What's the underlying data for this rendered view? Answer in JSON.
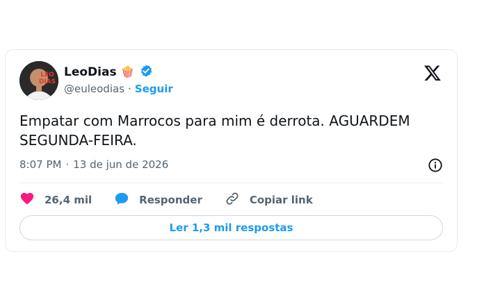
{
  "author": {
    "name": "LeoDias",
    "name_emoji": "🍿",
    "handle": "@euleodias",
    "separator": "·",
    "follow_label": "Seguir",
    "avatar_text": "LEO DIAS",
    "verified": true
  },
  "tweet": {
    "text": "Empatar com Marrocos para mim é derrota. AGUARDEM SEGUNDA-FEIRA.",
    "time": "8:07 PM",
    "date_separator": "·",
    "date": "13 de jun de 2026"
  },
  "actions": {
    "likes_count": "26,4 mil",
    "reply_label": "Responder",
    "copy_link_label": "Copiar link"
  },
  "replies_button_label": "Ler 1,3 mil respostas",
  "colors": {
    "accent": "#1d9bf0",
    "like": "#f91880",
    "text": "#0f1419",
    "secondary": "#536471"
  },
  "icons": [
    "x-logo-icon",
    "verified-badge-icon",
    "info-icon",
    "heart-icon",
    "reply-bubble-icon",
    "link-icon"
  ]
}
